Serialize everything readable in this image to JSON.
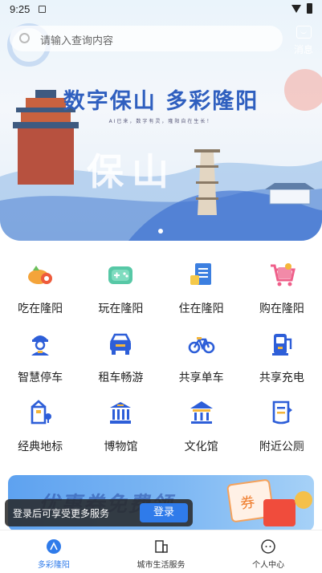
{
  "status": {
    "time": "9:25"
  },
  "search": {
    "placeholder": "请输入查询内容"
  },
  "header": {
    "messages_label": "消息"
  },
  "hero": {
    "title": "数字保山 多彩隆阳",
    "subtitle": "AI已来，数字有灵，隆阳自在生长！",
    "big_text": "保山"
  },
  "services": [
    [
      {
        "label": "吃在隆阳",
        "icon": "food-icon"
      },
      {
        "label": "玩在隆阳",
        "icon": "gamepad-icon"
      },
      {
        "label": "住在隆阳",
        "icon": "hotel-icon"
      },
      {
        "label": "购在隆阳",
        "icon": "shopping-cart-icon"
      }
    ],
    [
      {
        "label": "智慧停车",
        "icon": "parking-attendant-icon"
      },
      {
        "label": "租车畅游",
        "icon": "car-rental-icon"
      },
      {
        "label": "共享单车",
        "icon": "bicycle-icon"
      },
      {
        "label": "共享充电",
        "icon": "charging-station-icon"
      }
    ],
    [
      {
        "label": "经典地标",
        "icon": "landmark-icon"
      },
      {
        "label": "博物馆",
        "icon": "museum-icon"
      },
      {
        "label": "文化馆",
        "icon": "culture-hall-icon"
      },
      {
        "label": "附近公厕",
        "icon": "toilet-icon"
      }
    ]
  ],
  "promo": {
    "text": "优惠券免费领",
    "coupon_char": "券"
  },
  "toast": {
    "text": "登录后可享受更多服务",
    "button": "登录"
  },
  "nav": [
    {
      "label": "多彩隆阳",
      "icon": "home-icon",
      "active": true
    },
    {
      "label": "城市生活服务",
      "icon": "city-services-icon",
      "active": false
    },
    {
      "label": "个人中心",
      "icon": "profile-icon",
      "active": false
    }
  ],
  "colors": {
    "accent": "#2f7bea",
    "title": "#2f5fbf",
    "icon_blue": "#2d5ed8"
  }
}
